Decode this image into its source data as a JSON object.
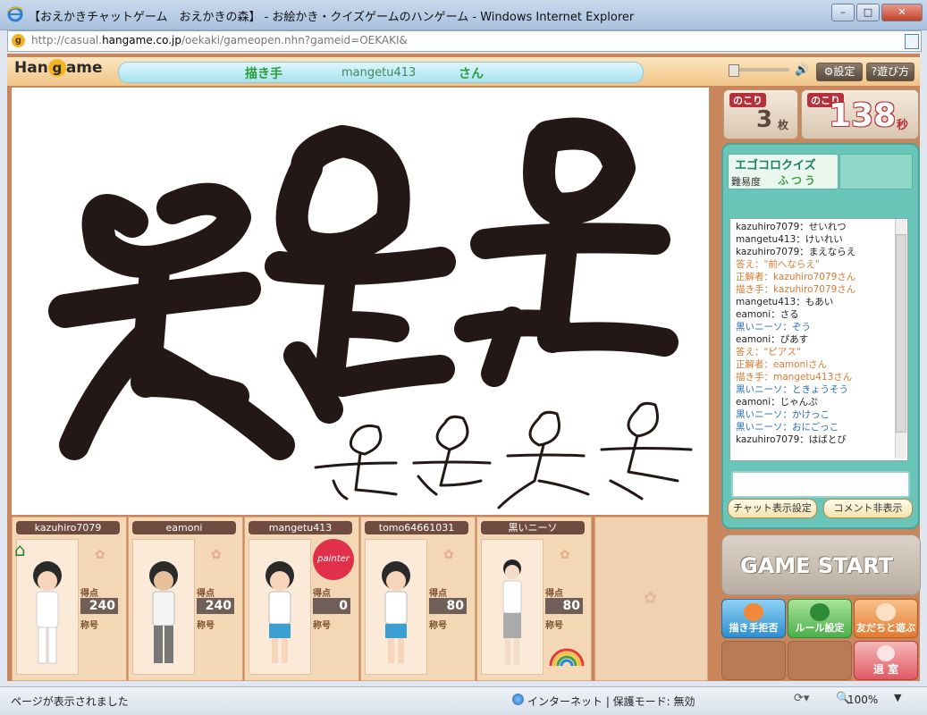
{
  "window": {
    "title": "【おえかきチャットゲーム　おえかきの森】 - お絵かき・クイズゲームのハンゲーム - Windows Internet Explorer",
    "address_prefix": "http://casual.",
    "address_domain": "hangame.co.jp",
    "address_path": "/oekaki/gameopen.nhn?gameid=OEKAKI&"
  },
  "header": {
    "logo": "Hangame",
    "drawer_label": "描き手",
    "drawer_name": "mangetu413",
    "drawer_suffix": "さん",
    "settings_label": "設定",
    "howto_label": "遊び方"
  },
  "counters": {
    "remaining_label": "のこり",
    "remaining_cards": "3",
    "cards_unit": "枚",
    "time_label": "のこり",
    "remaining_seconds": "138",
    "seconds_unit": "秒"
  },
  "quiz": {
    "title": "エゴコロクイズ",
    "difficulty_label": "難易度",
    "difficulty_value": "ふつう"
  },
  "chat": {
    "messages": [
      {
        "text": "kazuhiro7079：せいれつ",
        "kind": "u"
      },
      {
        "text": "mangetu413：けいれい",
        "kind": "u"
      },
      {
        "text": "kazuhiro7079：まえならえ",
        "kind": "u"
      },
      {
        "text": "答え：\"前へならえ\"",
        "kind": "o"
      },
      {
        "text": "正解者：kazuhiro7079さん",
        "kind": "o"
      },
      {
        "text": "描き手：kazuhiro7079さん",
        "kind": "o"
      },
      {
        "text": "mangetu413：もあい",
        "kind": "u"
      },
      {
        "text": "eamoni：さる",
        "kind": "u"
      },
      {
        "text": "黒いニーソ：ぞう",
        "kind": "b"
      },
      {
        "text": "eamoni：ぴあす",
        "kind": "u"
      },
      {
        "text": "答え：\"ピアス\"",
        "kind": "o"
      },
      {
        "text": "正解者：eamoniさん",
        "kind": "o"
      },
      {
        "text": "描き手：mangetu413さん",
        "kind": "o"
      },
      {
        "text": "黒いニーソ：ときょうそう",
        "kind": "b"
      },
      {
        "text": "eamoni：じゃんぷ",
        "kind": "u"
      },
      {
        "text": "黒いニーソ：かけっこ",
        "kind": "b"
      },
      {
        "text": "黒いニーソ：おにごっこ",
        "kind": "b"
      },
      {
        "text": "kazuhiro7079：はばとび",
        "kind": "u"
      }
    ],
    "input_value": "",
    "display_settings_label": "チャット表示設定",
    "hide_comments_label": "コメント非表示"
  },
  "controls": {
    "game_start_label": "GAME START",
    "refuse_drawer_label": "描き手拒否",
    "rule_settings_label": "ルール設定",
    "play_with_friends_label": "友だちと遊ぶ",
    "exit_label": "退 室"
  },
  "players": [
    {
      "name": "kazuhiro7079",
      "score_label": "得点",
      "score": "240",
      "title_label": "称号",
      "home": true
    },
    {
      "name": "eamoni",
      "score_label": "得点",
      "score": "240",
      "title_label": "称号"
    },
    {
      "name": "mangetu413",
      "score_label": "得点",
      "score": "0",
      "title_label": "称号",
      "painter_badge": "painter"
    },
    {
      "name": "tomo64661031",
      "score_label": "得点",
      "score": "80",
      "title_label": "称号"
    },
    {
      "name": "黒いニーソ",
      "score_label": "得点",
      "score": "80",
      "title_label": "称号"
    }
  ],
  "statusbar": {
    "status": "ページが表示されました",
    "zone": "インターネット | 保護モード: 無効",
    "zoom": "100%"
  },
  "colors": {
    "frame": "#c8865a",
    "quiz_panel": "#6ac5b9",
    "answer_text": "#d8792f",
    "guest_text": "#2a6fb5"
  }
}
